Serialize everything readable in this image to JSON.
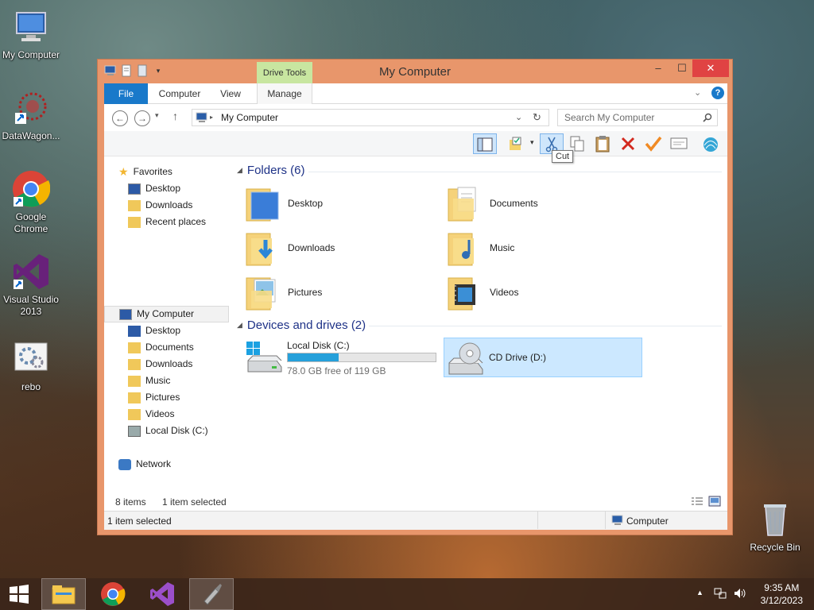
{
  "desktop": {
    "icons": [
      {
        "label": "My Computer"
      },
      {
        "label": "DataWagon..."
      },
      {
        "label": "Google Chrome"
      },
      {
        "label": "Visual Studio 2013"
      },
      {
        "label": "rebo"
      },
      {
        "label": "Recycle Bin"
      }
    ]
  },
  "window": {
    "title": "My Computer",
    "context_tab": "Drive Tools",
    "tabs": [
      {
        "label": "File"
      },
      {
        "label": "Computer"
      },
      {
        "label": "View"
      },
      {
        "label": "Manage"
      }
    ],
    "address": "My Computer",
    "search_placeholder": "Search My Computer",
    "tooltip": "Cut"
  },
  "navpane": {
    "favorites_label": "Favorites",
    "favorites": [
      {
        "label": "Desktop"
      },
      {
        "label": "Downloads"
      },
      {
        "label": "Recent places"
      }
    ],
    "computer_label": "My Computer",
    "computer_items": [
      {
        "label": "Desktop"
      },
      {
        "label": "Documents"
      },
      {
        "label": "Downloads"
      },
      {
        "label": "Music"
      },
      {
        "label": "Pictures"
      },
      {
        "label": "Videos"
      },
      {
        "label": "Local Disk (C:)"
      }
    ],
    "network_label": "Network"
  },
  "main": {
    "folders_header": "Folders (6)",
    "folders": [
      {
        "label": "Desktop"
      },
      {
        "label": "Documents"
      },
      {
        "label": "Downloads"
      },
      {
        "label": "Music"
      },
      {
        "label": "Pictures"
      },
      {
        "label": "Videos"
      }
    ],
    "devices_header": "Devices and drives (2)",
    "drives": [
      {
        "label": "Local Disk (C:)",
        "free": "78.0 GB free of 119 GB",
        "used_fraction": 0.345
      },
      {
        "label": "CD Drive (D:)"
      }
    ]
  },
  "status": {
    "items": "8 items",
    "selected": "1 item selected",
    "bottom_selected": "1 item selected",
    "location": "Computer"
  },
  "taskbar": {
    "time": "9:35 AM",
    "date": "3/12/2023"
  },
  "colors": {
    "window_frame": "#e8966b",
    "file_tab": "#1979ca",
    "drive_tools": "#c8e6a0",
    "selection": "#cce8ff",
    "close": "#e04343"
  }
}
